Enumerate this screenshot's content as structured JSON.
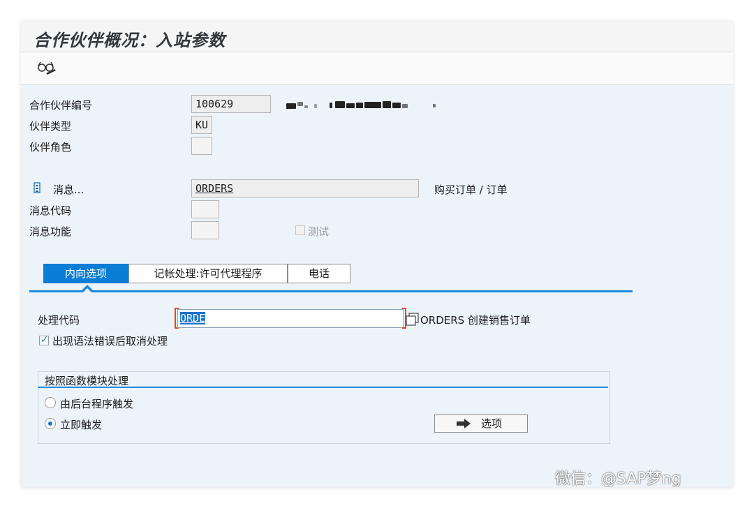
{
  "window": {
    "title": "合作伙伴概况：入站参数"
  },
  "toolbar": {
    "glasses_icon": "display-glasses-icon"
  },
  "header": {
    "partner_no_label": "合作伙伴编号",
    "partner_no_value": "100629",
    "partner_type_label": "伙伴类型",
    "partner_type_value": "KU",
    "partner_role_label": "伙伴角色",
    "partner_role_value": ""
  },
  "message": {
    "label": "消息...",
    "value": "ORDERS",
    "description": "购买订单 / 订单",
    "code_label": "消息代码",
    "code_value": "",
    "function_label": "消息功能",
    "function_value": "",
    "test_label": "测试"
  },
  "tabs": [
    {
      "label": "内向选项",
      "active": true
    },
    {
      "label": "记帐处理:许可代理程序",
      "active": false
    },
    {
      "label": "电话",
      "active": false
    }
  ],
  "inbound": {
    "process_code_label": "处理代码",
    "process_code_value": "ORDE",
    "process_code_description": "ORDERS 创建销售订单",
    "cancel_on_error_label": "出现语法错误后取消处理",
    "cancel_on_error_checked": true
  },
  "processing_group": {
    "title": "按照函数模块处理",
    "options": [
      {
        "label": "由后台程序触发",
        "selected": false
      },
      {
        "label": "立即触发",
        "selected": true
      }
    ],
    "options_button_label": "选项"
  },
  "watermark": "微信：@SAP梦ng",
  "colors": {
    "accent": "#0a7ed6",
    "background": "#ecf3f9",
    "error_bracket": "#e04a1c"
  }
}
